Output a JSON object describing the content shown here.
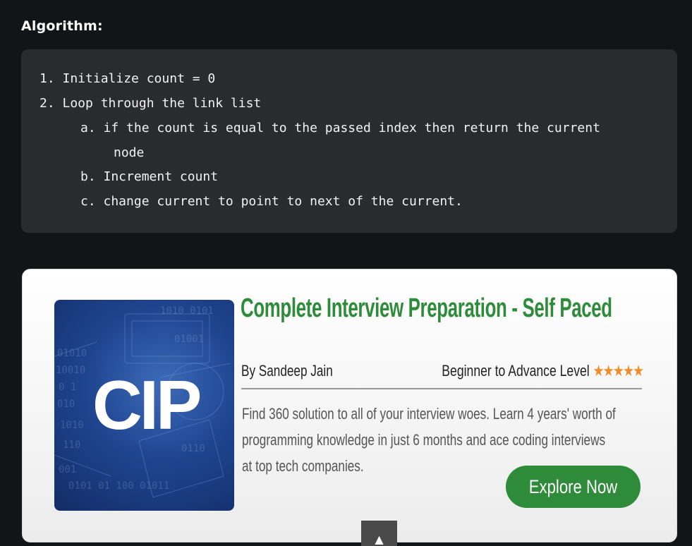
{
  "section": {
    "heading": "Algorithm:"
  },
  "code": {
    "lines": [
      "1. Initialize count = 0",
      "2. Loop through the link list",
      "a. if the count is equal to the passed index then return the current",
      "node",
      "b. Increment count",
      "c. change current to point to next of the current."
    ]
  },
  "ad": {
    "logo_text": "CIP",
    "title": "Complete Interview Preparation - Self Paced",
    "author": "By Sandeep Jain",
    "level": "Beginner to Advance Level",
    "rating_stars": "★★★★★",
    "description": [
      "Find 360 solution to all of your interview woes. Learn 4 years' worth of",
      "programming knowledge in just 6 months and ace coding interviews",
      "at top tech companies."
    ],
    "cta_label": "Explore Now",
    "colors": {
      "accent": "#2e8b3a",
      "star": "#f28c28"
    }
  },
  "scroll_top": {
    "icon": "arrow-up-icon",
    "glyph": "▲"
  }
}
